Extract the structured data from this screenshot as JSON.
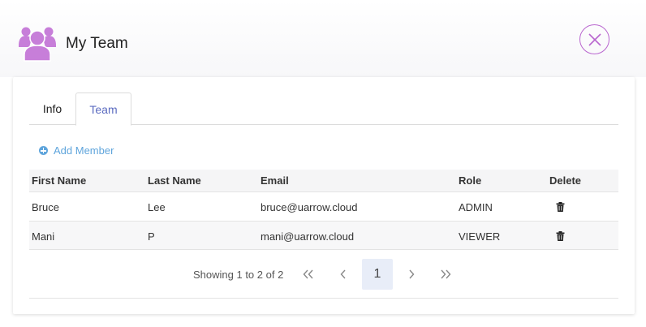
{
  "header": {
    "title": "My Team"
  },
  "tabs": [
    {
      "label": "Info",
      "active": false
    },
    {
      "label": "Team",
      "active": true
    }
  ],
  "actions": {
    "add_member_label": "Add Member"
  },
  "table": {
    "columns": [
      "First Name",
      "Last Name",
      "Email",
      "Role",
      "Delete"
    ],
    "rows": [
      {
        "first_name": "Bruce",
        "last_name": "Lee",
        "email": "bruce@uarrow.cloud",
        "role": "ADMIN"
      },
      {
        "first_name": "Mani",
        "last_name": "P",
        "email": "mani@uarrow.cloud",
        "role": "VIEWER"
      }
    ]
  },
  "pagination": {
    "summary": "Showing 1 to 2 of 2",
    "current_page": "1"
  },
  "icons": {
    "team": "team-icon",
    "close": "close-icon",
    "add": "plus-circle-icon",
    "delete": "trash-icon",
    "first": "double-chevron-left-icon",
    "prev": "chevron-left-icon",
    "next": "chevron-right-icon",
    "last": "double-chevron-right-icon"
  },
  "colors": {
    "brand": "#c77ed9",
    "accent": "#5b6bc0",
    "link": "#5fa5dc",
    "active_page_bg": "#e8edf8"
  }
}
